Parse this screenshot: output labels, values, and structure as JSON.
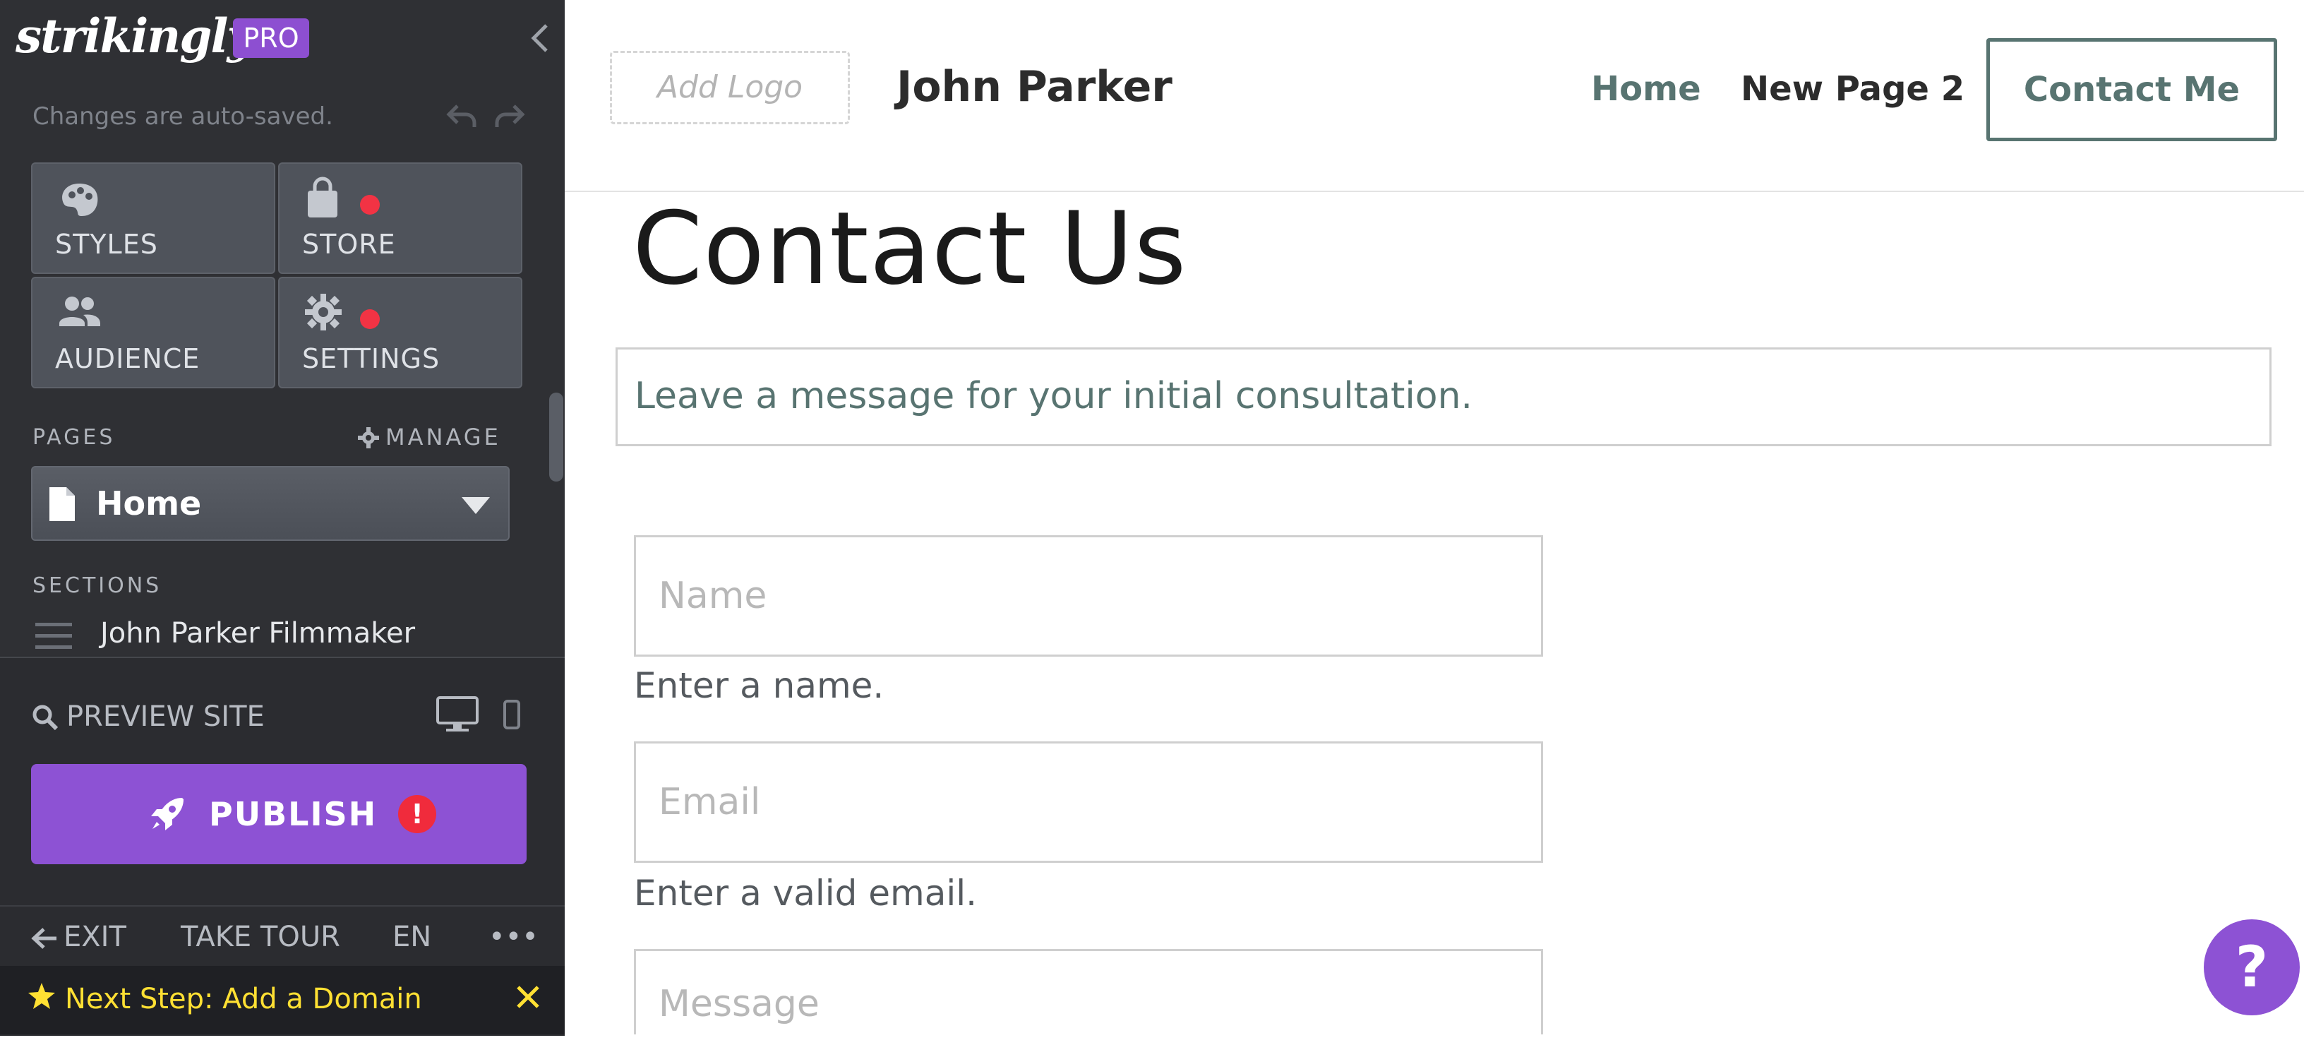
{
  "sidebar": {
    "brand": "strikingly",
    "badge": "PRO",
    "autosave_text": "Changes are auto-saved.",
    "tiles": [
      {
        "label": "STYLES",
        "icon": "palette-icon"
      },
      {
        "label": "STORE",
        "icon": "shopping-bag-icon",
        "notification": true
      },
      {
        "label": "AUDIENCE",
        "icon": "people-icon"
      },
      {
        "label": "SETTINGS",
        "icon": "gear-icon",
        "notification": true
      }
    ],
    "pages_label": "PAGES",
    "manage_label": "MANAGE",
    "current_page": "Home",
    "sections_label": "SECTIONS",
    "sections": [
      "John Parker Filmmaker"
    ],
    "preview_label": "PREVIEW SITE",
    "publish_label": "PUBLISH",
    "publish_alert": "!",
    "footer": {
      "exit": "EXIT",
      "tour": "TAKE TOUR",
      "lang": "EN",
      "more": "•••"
    },
    "next_step": "Next Step: Add a Domain",
    "colors": {
      "accent": "#8d52d4",
      "notification": "#f23344",
      "next_step_text": "#ffe033"
    }
  },
  "site": {
    "logo_placeholder": "Add Logo",
    "name": "John Parker",
    "nav": [
      "Home",
      "New Page 2"
    ],
    "cta": "Contact Me",
    "title": "Contact Us",
    "intro": "Leave a message for your initial consultation.",
    "form": {
      "name_placeholder": "Name",
      "name_hint": "Enter a name.",
      "email_placeholder": "Email",
      "email_hint": "Enter a valid email.",
      "message_placeholder": "Message"
    },
    "help": "?",
    "colors": {
      "accent": "#587471"
    }
  }
}
